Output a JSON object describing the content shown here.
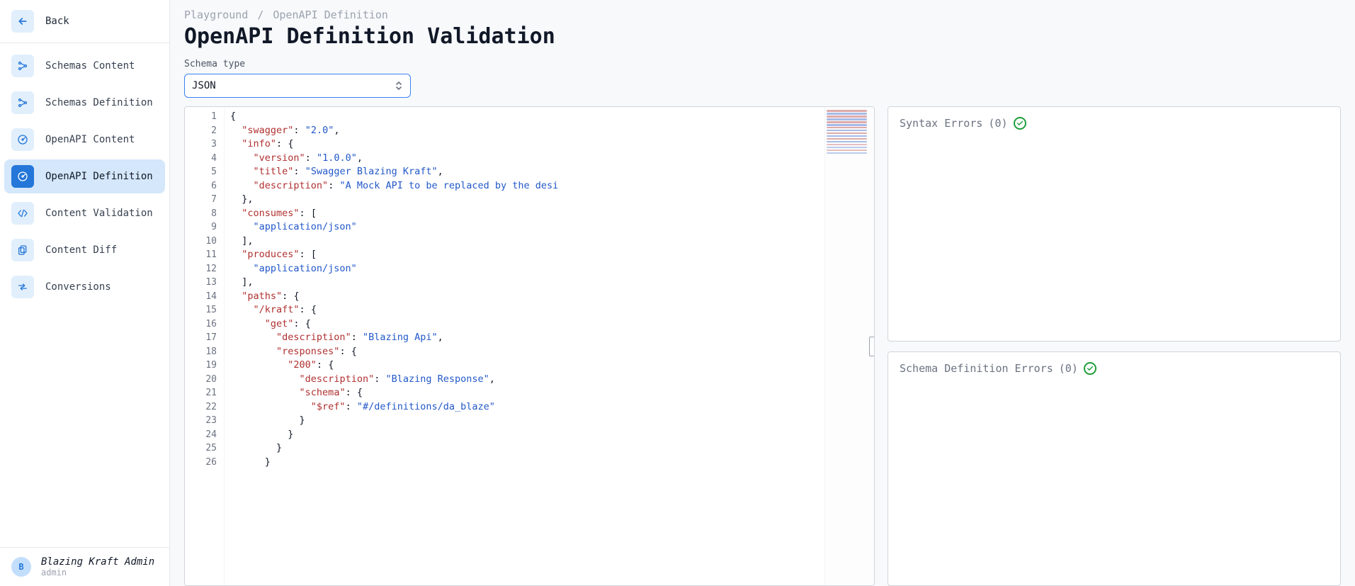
{
  "sidebar": {
    "back_label": "Back",
    "items": [
      {
        "label": "Schemas Content",
        "icon": "nodes-icon"
      },
      {
        "label": "Schemas Definition",
        "icon": "nodes-icon"
      },
      {
        "label": "OpenAPI Content",
        "icon": "gauge-icon"
      },
      {
        "label": "OpenAPI Definition",
        "icon": "gauge-icon"
      },
      {
        "label": "Content Validation",
        "icon": "code-icon"
      },
      {
        "label": "Content Diff",
        "icon": "copy-doc-icon"
      },
      {
        "label": "Conversions",
        "icon": "swap-icon"
      }
    ],
    "active_index": 3
  },
  "user": {
    "avatar_initial": "B",
    "name": "Blazing Kraft Admin",
    "role": "admin"
  },
  "breadcrumb": {
    "parent": "Playground",
    "current": "OpenAPI Definition"
  },
  "page_title": "OpenAPI Definition Validation",
  "schema_type": {
    "label": "Schema type",
    "selected": "JSON"
  },
  "editor": {
    "lines": [
      [
        {
          "k": "brace",
          "t": "{"
        }
      ],
      [
        {
          "k": "indent",
          "n": 1
        },
        {
          "k": "key",
          "t": "\"swagger\""
        },
        {
          "k": "punct",
          "t": ": "
        },
        {
          "k": "str",
          "t": "\"2.0\""
        },
        {
          "k": "punct",
          "t": ","
        }
      ],
      [
        {
          "k": "indent",
          "n": 1
        },
        {
          "k": "key",
          "t": "\"info\""
        },
        {
          "k": "punct",
          "t": ": "
        },
        {
          "k": "brace",
          "t": "{"
        }
      ],
      [
        {
          "k": "indent",
          "n": 2
        },
        {
          "k": "key",
          "t": "\"version\""
        },
        {
          "k": "punct",
          "t": ": "
        },
        {
          "k": "str",
          "t": "\"1.0.0\""
        },
        {
          "k": "punct",
          "t": ","
        }
      ],
      [
        {
          "k": "indent",
          "n": 2
        },
        {
          "k": "key",
          "t": "\"title\""
        },
        {
          "k": "punct",
          "t": ": "
        },
        {
          "k": "str",
          "t": "\"Swagger Blazing Kraft\""
        },
        {
          "k": "punct",
          "t": ","
        }
      ],
      [
        {
          "k": "indent",
          "n": 2
        },
        {
          "k": "key",
          "t": "\"description\""
        },
        {
          "k": "punct",
          "t": ": "
        },
        {
          "k": "str",
          "t": "\"A Mock API to be replaced by the desi"
        }
      ],
      [
        {
          "k": "indent",
          "n": 1
        },
        {
          "k": "brace",
          "t": "}"
        },
        {
          "k": "punct",
          "t": ","
        }
      ],
      [
        {
          "k": "indent",
          "n": 1
        },
        {
          "k": "key",
          "t": "\"consumes\""
        },
        {
          "k": "punct",
          "t": ": "
        },
        {
          "k": "brace",
          "t": "["
        }
      ],
      [
        {
          "k": "indent",
          "n": 2
        },
        {
          "k": "str",
          "t": "\"application/json\""
        }
      ],
      [
        {
          "k": "indent",
          "n": 1
        },
        {
          "k": "brace",
          "t": "]"
        },
        {
          "k": "punct",
          "t": ","
        }
      ],
      [
        {
          "k": "indent",
          "n": 1
        },
        {
          "k": "key",
          "t": "\"produces\""
        },
        {
          "k": "punct",
          "t": ": "
        },
        {
          "k": "brace",
          "t": "["
        }
      ],
      [
        {
          "k": "indent",
          "n": 2
        },
        {
          "k": "str",
          "t": "\"application/json\""
        }
      ],
      [
        {
          "k": "indent",
          "n": 1
        },
        {
          "k": "brace",
          "t": "]"
        },
        {
          "k": "punct",
          "t": ","
        }
      ],
      [
        {
          "k": "indent",
          "n": 1
        },
        {
          "k": "key",
          "t": "\"paths\""
        },
        {
          "k": "punct",
          "t": ": "
        },
        {
          "k": "brace",
          "t": "{"
        }
      ],
      [
        {
          "k": "indent",
          "n": 2
        },
        {
          "k": "key",
          "t": "\"/kraft\""
        },
        {
          "k": "punct",
          "t": ": "
        },
        {
          "k": "brace",
          "t": "{"
        }
      ],
      [
        {
          "k": "indent",
          "n": 3
        },
        {
          "k": "key",
          "t": "\"get\""
        },
        {
          "k": "punct",
          "t": ": "
        },
        {
          "k": "brace",
          "t": "{"
        }
      ],
      [
        {
          "k": "indent",
          "n": 4
        },
        {
          "k": "key",
          "t": "\"description\""
        },
        {
          "k": "punct",
          "t": ": "
        },
        {
          "k": "str",
          "t": "\"Blazing Api\""
        },
        {
          "k": "punct",
          "t": ","
        }
      ],
      [
        {
          "k": "indent",
          "n": 4
        },
        {
          "k": "key",
          "t": "\"responses\""
        },
        {
          "k": "punct",
          "t": ": "
        },
        {
          "k": "brace",
          "t": "{"
        }
      ],
      [
        {
          "k": "indent",
          "n": 5
        },
        {
          "k": "key",
          "t": "\"200\""
        },
        {
          "k": "punct",
          "t": ": "
        },
        {
          "k": "brace",
          "t": "{"
        }
      ],
      [
        {
          "k": "indent",
          "n": 6
        },
        {
          "k": "key",
          "t": "\"description\""
        },
        {
          "k": "punct",
          "t": ": "
        },
        {
          "k": "str",
          "t": "\"Blazing Response\""
        },
        {
          "k": "punct",
          "t": ","
        }
      ],
      [
        {
          "k": "indent",
          "n": 6
        },
        {
          "k": "key",
          "t": "\"schema\""
        },
        {
          "k": "punct",
          "t": ": "
        },
        {
          "k": "brace",
          "t": "{"
        }
      ],
      [
        {
          "k": "indent",
          "n": 7
        },
        {
          "k": "key",
          "t": "\"$ref\""
        },
        {
          "k": "punct",
          "t": ": "
        },
        {
          "k": "str",
          "t": "\"#/definitions/da_blaze\""
        }
      ],
      [
        {
          "k": "indent",
          "n": 6
        },
        {
          "k": "brace",
          "t": "}"
        }
      ],
      [
        {
          "k": "indent",
          "n": 5
        },
        {
          "k": "brace",
          "t": "}"
        }
      ],
      [
        {
          "k": "indent",
          "n": 4
        },
        {
          "k": "brace",
          "t": "}"
        }
      ],
      [
        {
          "k": "indent",
          "n": 3
        },
        {
          "k": "brace",
          "t": "}"
        }
      ]
    ]
  },
  "errors": {
    "syntax": {
      "title": "Syntax Errors",
      "count": 0
    },
    "schema": {
      "title": "Schema Definition Errors",
      "count": 0
    }
  }
}
